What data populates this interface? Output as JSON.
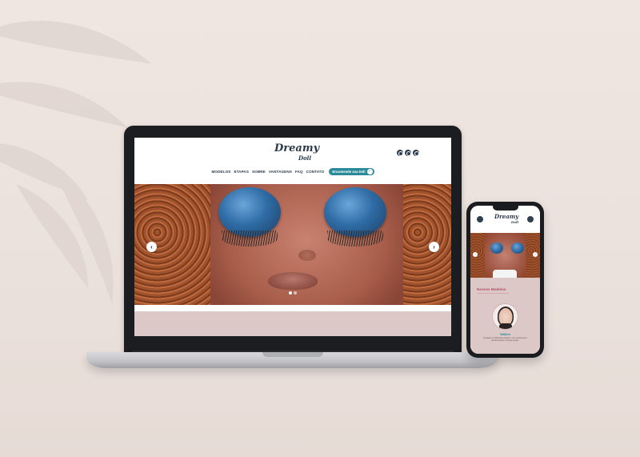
{
  "brand": {
    "logo_main": "Dreamy",
    "logo_sub": "Doll"
  },
  "desktop": {
    "nav": [
      "MODELOS",
      "ETAPAS",
      "SOBRE",
      "VANTAGENS",
      "FAQ",
      "CONTATO"
    ],
    "cta_label": "Encomende sua Doll",
    "social_icons": [
      "instagram-icon",
      "tiktok-icon",
      "youtube-icon"
    ],
    "slider": {
      "prev": "‹",
      "next": "›",
      "slides": 2,
      "active_slide": 1
    }
  },
  "mobile": {
    "section_title": "Nossos Modelos",
    "model_name": "Wilkim",
    "model_description": "Inspirada em Wandinha Addams, com vestido preto, golinha branca e tranças longas."
  },
  "colors": {
    "accent": "#2b8a9a",
    "navy": "#2b3a4a",
    "pink_band": "#dcc8c6",
    "title_pink": "#b0506a"
  }
}
